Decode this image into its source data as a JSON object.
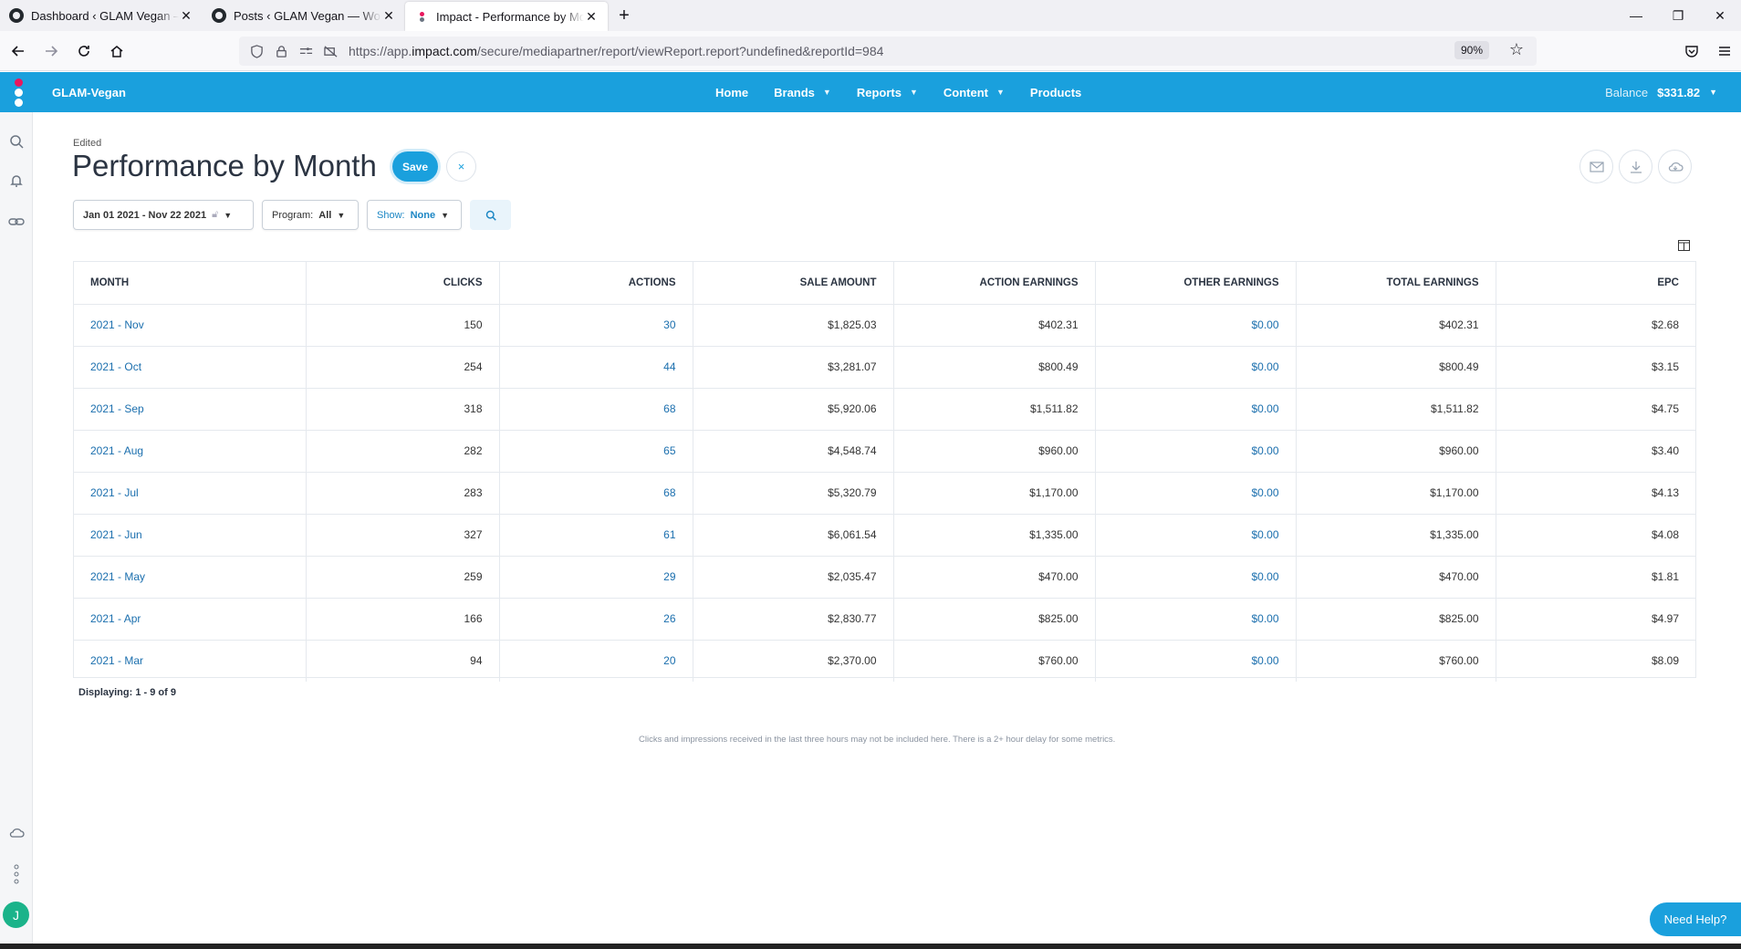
{
  "browser": {
    "tabs": [
      {
        "title": "Dashboard ‹ GLAM Vegan — WordPress",
        "close": "✕",
        "active": false
      },
      {
        "title": "Posts ‹ GLAM Vegan — WordPress",
        "close": "✕",
        "active": false
      },
      {
        "title": "Impact - Performance by Month",
        "close": "✕",
        "active": true
      }
    ],
    "new_tab": "+",
    "url_prefix": "https://app.",
    "url_domain": "impact.com",
    "url_path": "/secure/mediapartner/report/viewReport.report?undefined&reportId=984",
    "zoom": "90%"
  },
  "app": {
    "account_name": "GLAM-Vegan",
    "nav": [
      {
        "label": "Home",
        "has_caret": false
      },
      {
        "label": "Brands",
        "has_caret": true
      },
      {
        "label": "Reports",
        "has_caret": true
      },
      {
        "label": "Content",
        "has_caret": true
      },
      {
        "label": "Products",
        "has_caret": false
      }
    ],
    "balance_label": "Balance",
    "balance_value": "$331.82",
    "user_initial": "J",
    "brand_colors": {
      "primary": "#1aa0dd",
      "logo_red": "#e8175d"
    }
  },
  "report": {
    "status": "Edited",
    "title": "Performance by Month",
    "save_label": "Save",
    "close_label": "×",
    "date_range": "Jan 01 2021 - Nov 22 2021",
    "program_label": "Program:",
    "program_value": "All",
    "show_label": "Show:",
    "show_value": "None"
  },
  "table": {
    "columns": [
      "MONTH",
      "CLICKS",
      "ACTIONS",
      "SALE AMOUNT",
      "ACTION EARNINGS",
      "OTHER EARNINGS",
      "TOTAL EARNINGS",
      "EPC"
    ],
    "rows": [
      [
        "2021 - Nov",
        "150",
        "30",
        "$1,825.03",
        "$402.31",
        "$0.00",
        "$402.31",
        "$2.68"
      ],
      [
        "2021 - Oct",
        "254",
        "44",
        "$3,281.07",
        "$800.49",
        "$0.00",
        "$800.49",
        "$3.15"
      ],
      [
        "2021 - Sep",
        "318",
        "68",
        "$5,920.06",
        "$1,511.82",
        "$0.00",
        "$1,511.82",
        "$4.75"
      ],
      [
        "2021 - Aug",
        "282",
        "65",
        "$4,548.74",
        "$960.00",
        "$0.00",
        "$960.00",
        "$3.40"
      ],
      [
        "2021 - Jul",
        "283",
        "68",
        "$5,320.79",
        "$1,170.00",
        "$0.00",
        "$1,170.00",
        "$4.13"
      ],
      [
        "2021 - Jun",
        "327",
        "61",
        "$6,061.54",
        "$1,335.00",
        "$0.00",
        "$1,335.00",
        "$4.08"
      ],
      [
        "2021 - May",
        "259",
        "29",
        "$2,035.47",
        "$470.00",
        "$0.00",
        "$470.00",
        "$1.81"
      ],
      [
        "2021 - Apr",
        "166",
        "26",
        "$2,830.77",
        "$825.00",
        "$0.00",
        "$825.00",
        "$4.97"
      ],
      [
        "2021 - Mar",
        "94",
        "20",
        "$2,370.00",
        "$760.00",
        "$0.00",
        "$760.00",
        "$8.09"
      ]
    ],
    "link_columns": [
      0,
      2,
      5
    ],
    "displaying": "Displaying: 1 - 9 of 9"
  },
  "footnote": "Clicks and impressions received in the last three hours may not be included here. There is a 2+ hour delay for some metrics.",
  "help_label": "Need Help?"
}
